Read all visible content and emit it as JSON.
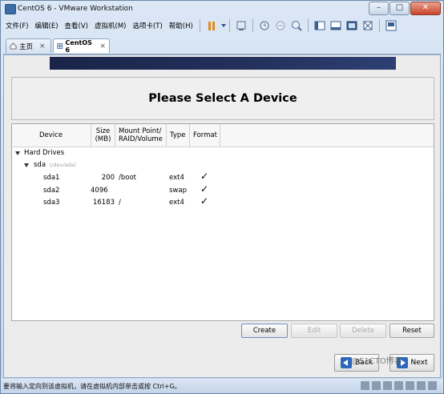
{
  "window": {
    "title": "CentOS 6 - VMware Workstation"
  },
  "menubar": {
    "items": [
      "文件(F)",
      "编辑(E)",
      "查看(V)",
      "虚拟机(M)",
      "选项卡(T)",
      "帮助(H)"
    ]
  },
  "tabs": [
    {
      "label": "主页",
      "close": "×"
    },
    {
      "label": "CentOS 6",
      "close": "×"
    }
  ],
  "installer": {
    "heading": "Please Select A Device",
    "columns": {
      "device": "Device",
      "size_line1": "Size",
      "size_line2": "(MB)",
      "mount_line1": "Mount Point/",
      "mount_line2": "RAID/Volume",
      "type": "Type",
      "format": "Format"
    },
    "tree": {
      "group": "Hard Drives",
      "disk": "sda",
      "disk_path": "(/dev/sda)",
      "partitions": [
        {
          "device": "sda1",
          "size": "200",
          "mount": "/boot",
          "type": "ext4",
          "format": true
        },
        {
          "device": "sda2",
          "size": "4096",
          "mount": "",
          "type": "swap",
          "format": true
        },
        {
          "device": "sda3",
          "size": "16183",
          "mount": "/",
          "type": "ext4",
          "format": true
        }
      ]
    },
    "buttons": {
      "create": "Create",
      "edit": "Edit",
      "delete": "Delete",
      "reset": "Reset"
    },
    "nav": {
      "back": "Back",
      "next": "Next"
    }
  },
  "statusbar": {
    "message": "要将输入定向到该虚拟机，请在虚拟机内部单击或按 Ctrl+G。"
  },
  "watermark": "@51CTO博客",
  "colors": {
    "banner": "#1a2448",
    "accent": "#2d67b8",
    "close": "#c8432a",
    "pause": "#e08a1e"
  }
}
